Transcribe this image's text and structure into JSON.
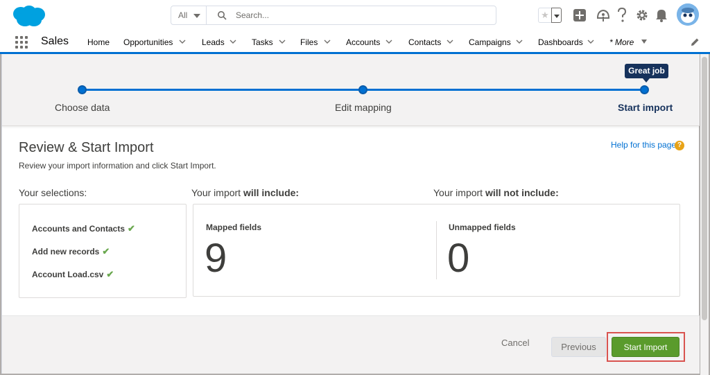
{
  "header": {
    "search_scope": "All",
    "search_placeholder": "Search..."
  },
  "nav": {
    "app_name": "Sales",
    "items": [
      {
        "label": "Home",
        "has_caret": false
      },
      {
        "label": "Opportunities",
        "has_caret": true
      },
      {
        "label": "Leads",
        "has_caret": true
      },
      {
        "label": "Tasks",
        "has_caret": true
      },
      {
        "label": "Files",
        "has_caret": true
      },
      {
        "label": "Accounts",
        "has_caret": true
      },
      {
        "label": "Contacts",
        "has_caret": true
      },
      {
        "label": "Campaigns",
        "has_caret": true
      },
      {
        "label": "Dashboards",
        "has_caret": true
      }
    ],
    "more_label": "* More"
  },
  "path": {
    "tooltip": "Great job",
    "steps": [
      "Choose data",
      "Edit mapping",
      "Start import"
    ]
  },
  "page": {
    "title": "Review & Start Import",
    "subtitle": "Review your import information and click Start Import.",
    "help_link": "Help for this page",
    "help_icon_glyph": "?"
  },
  "selections": {
    "heading": "Your selections:",
    "items": [
      "Accounts and Contacts",
      "Add new records",
      "Account Load.csv"
    ]
  },
  "include": {
    "heading_prefix": "Your import ",
    "heading_bold": "will include:",
    "label": "Mapped fields",
    "count": "9"
  },
  "exclude": {
    "heading_prefix": "Your import ",
    "heading_bold": "will not include:",
    "label": "Unmapped fields",
    "count": "0"
  },
  "footer": {
    "cancel": "Cancel",
    "previous": "Previous",
    "start_import": "Start Import"
  },
  "colors": {
    "brand_blue": "#0070d2",
    "start_green": "#5a9b2c",
    "highlight_red": "#d9534f"
  }
}
